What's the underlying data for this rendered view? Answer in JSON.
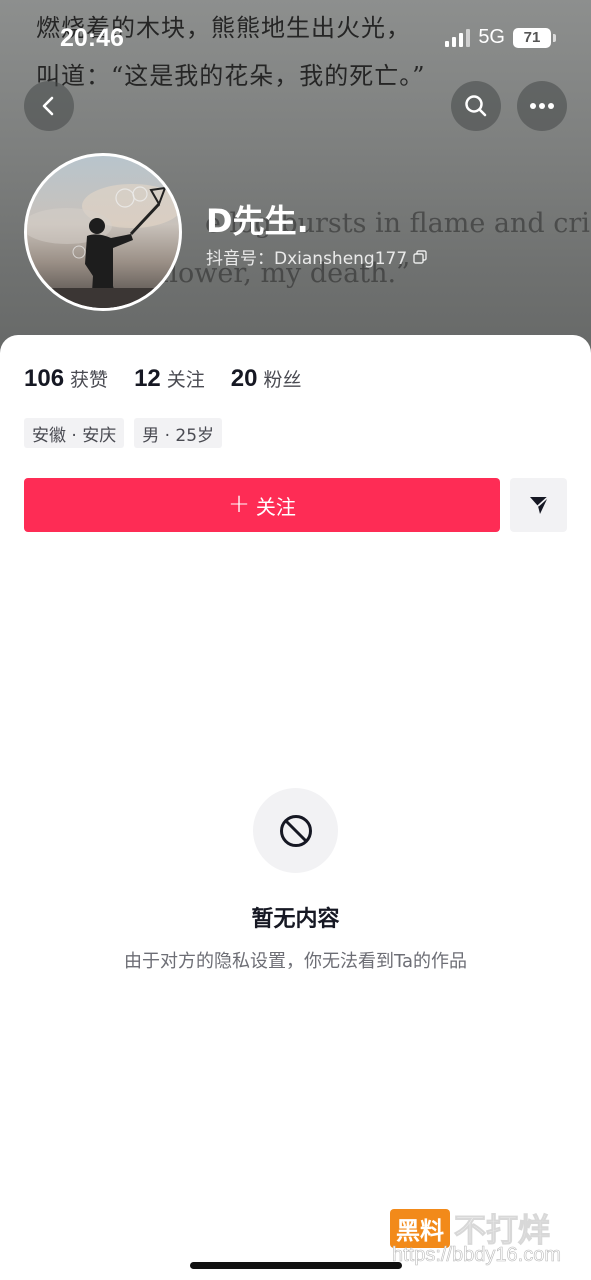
{
  "status_bar": {
    "time": "20:46",
    "network": "5G",
    "battery": "71"
  },
  "cover": {
    "line1": "燃烧着的木块，熊熊地生出火光，",
    "line2": "叫道：“这是我的花朵，我的死亡。”",
    "en_line1": "e log bursts in flame and cries,",
    "en_line2": "flower, my death.”"
  },
  "header": {
    "back_icon": "chevron-left-icon",
    "search_icon": "search-icon",
    "more_icon": "more-horizontal-icon"
  },
  "profile": {
    "nickname": "D先生.",
    "douyin_id": "抖音号：Dxiansheng177",
    "stats": [
      {
        "value": "106",
        "label": "获赞"
      },
      {
        "value": "12",
        "label": "关注"
      },
      {
        "value": "20",
        "label": "粉丝"
      }
    ],
    "tags": [
      "安徽 · 安庆",
      "男 · 25岁"
    ]
  },
  "actions": {
    "follow_label": "关注",
    "follow_icon": "+",
    "share_icon": "send-icon"
  },
  "empty_state": {
    "icon": "block-icon",
    "title": "暂无内容",
    "description": "由于对方的隐私设置，你无法看到Ta的作品"
  },
  "watermark": {
    "badge": "黑料",
    "text": "不打烊",
    "url": "https://bbdy16.com"
  },
  "colors": {
    "accent": "#fe2c55",
    "card_bg": "#ffffff",
    "chip_bg": "#f2f2f4"
  }
}
